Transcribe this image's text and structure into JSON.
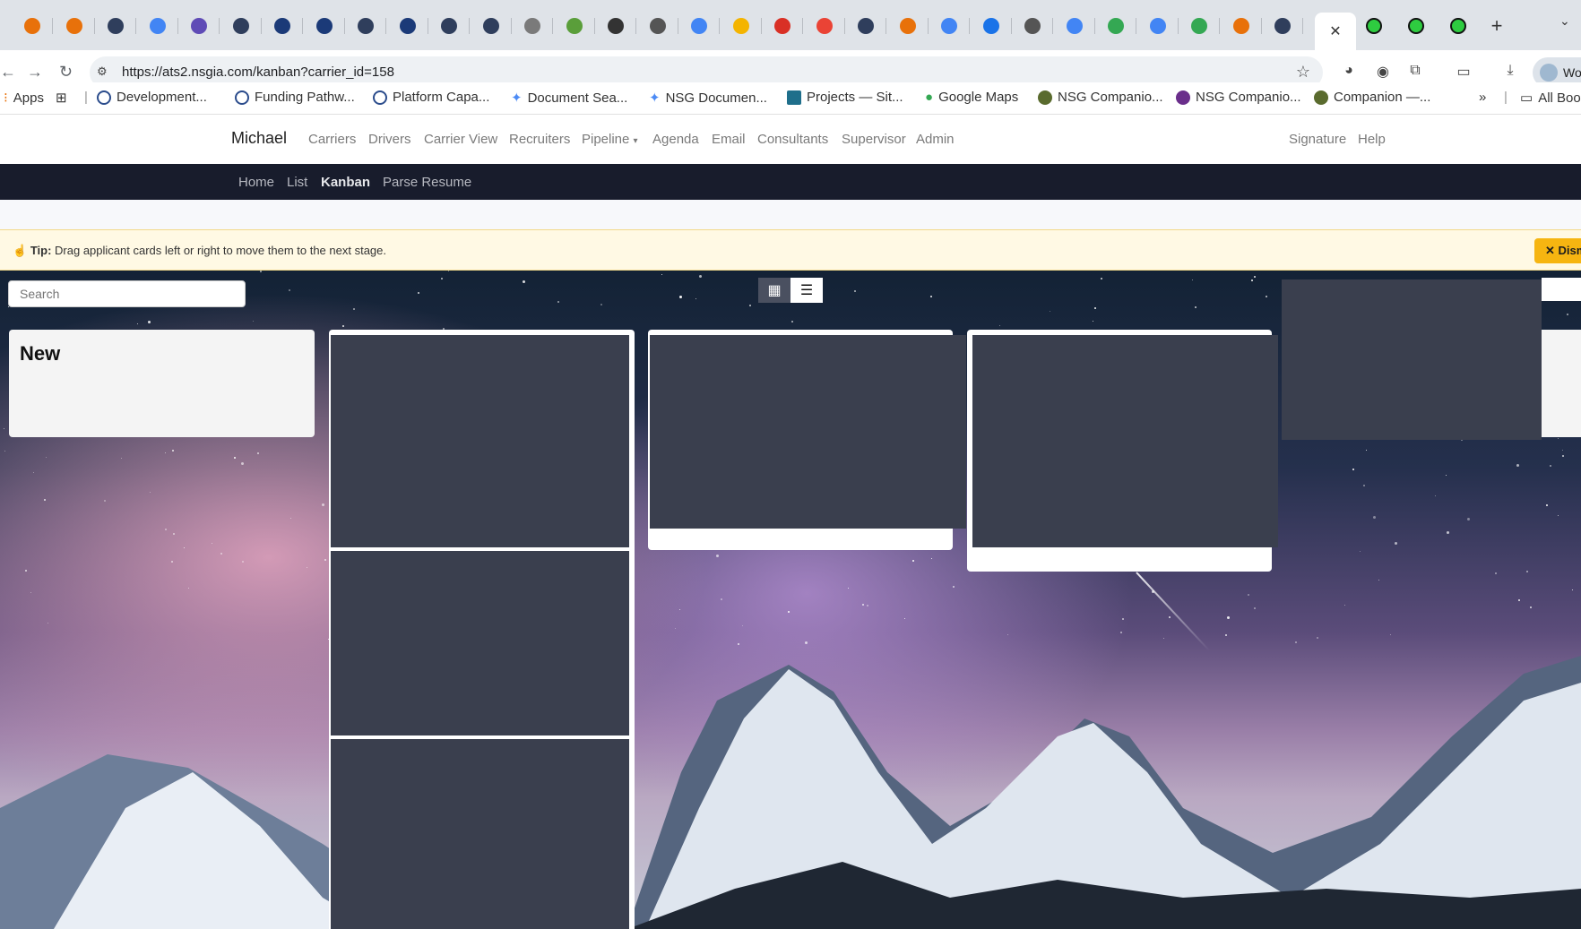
{
  "browser": {
    "url": "https://ats2.nsgia.com/kanban?carrier_id=158",
    "profile_label": "Wo",
    "bookmarks": [
      {
        "label": "Apps"
      },
      {
        "label": "Development..."
      },
      {
        "label": "Funding Pathw..."
      },
      {
        "label": "Platform Capa..."
      },
      {
        "label": "Document Sea..."
      },
      {
        "label": "NSG Documen..."
      },
      {
        "label": "Projects — Sit..."
      },
      {
        "label": "Google Maps"
      },
      {
        "label": "NSG Companio..."
      },
      {
        "label": "NSG Companio..."
      },
      {
        "label": "Companion —..."
      }
    ],
    "overflow_label": "»",
    "all_bookmarks_label": "All Boo"
  },
  "app": {
    "brand": "Michael",
    "nav": [
      "Carriers",
      "Drivers",
      "Carrier View",
      "Recruiters",
      "Pipeline",
      "Agenda",
      "Email",
      "Consultants",
      "Supervisor",
      "Admin"
    ],
    "nav_right": [
      "Signature",
      "Help"
    ],
    "subnav": [
      "Home",
      "List",
      "Kanban",
      "Parse Resume"
    ],
    "active_subnav": "Kanban"
  },
  "tip": {
    "label": "Tip:",
    "text": "Drag applicant cards left or right to move them to the next stage.",
    "dismiss_label": "✕ Dism"
  },
  "board": {
    "search_placeholder": "Search",
    "columns": [
      {
        "title": "New",
        "cards": 0
      },
      {
        "title": "",
        "cards": 3
      },
      {
        "title": "",
        "cards": 1
      },
      {
        "title": "",
        "cards": 1
      },
      {
        "title": "",
        "cards": 1
      }
    ]
  },
  "colors": {
    "subnav_bg": "#181c2c",
    "card_bg": "#3a3f4e",
    "tip_bg": "#fff9e4",
    "dismiss_bg": "#f6b511"
  }
}
